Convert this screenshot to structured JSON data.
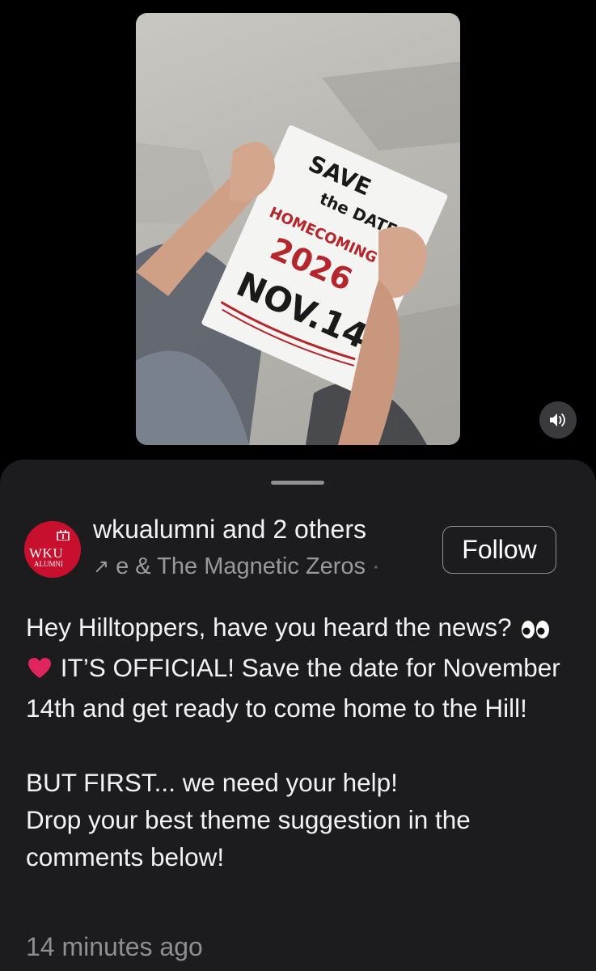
{
  "video": {
    "sign_text": {
      "line1": "SAVE",
      "line2": "the DATE",
      "line3": "HOMECOMING",
      "line4": "2026",
      "line5": "NOV.14"
    },
    "mute_icon": "speaker-icon"
  },
  "post": {
    "account_name": "wkualumni",
    "coauthors": " and 2 others",
    "audio_track": "e & The Magnetic Zeros",
    "audio_separator": "·",
    "follow_label": "Follow",
    "avatar": {
      "text": "WKU",
      "subtext": "ALUMNI",
      "brand_color": "#c8102e"
    },
    "caption": {
      "line1a": "Hey Hilltoppers, have you heard the news?",
      "line1b": "IT’S OFFICIAL! Save the date for November 14th and get ready to come home to the Hill!",
      "line2": "BUT FIRST... we need your help!",
      "line3": "Drop your best theme suggestion in the comments below!"
    },
    "timestamp": "14 minutes ago"
  }
}
